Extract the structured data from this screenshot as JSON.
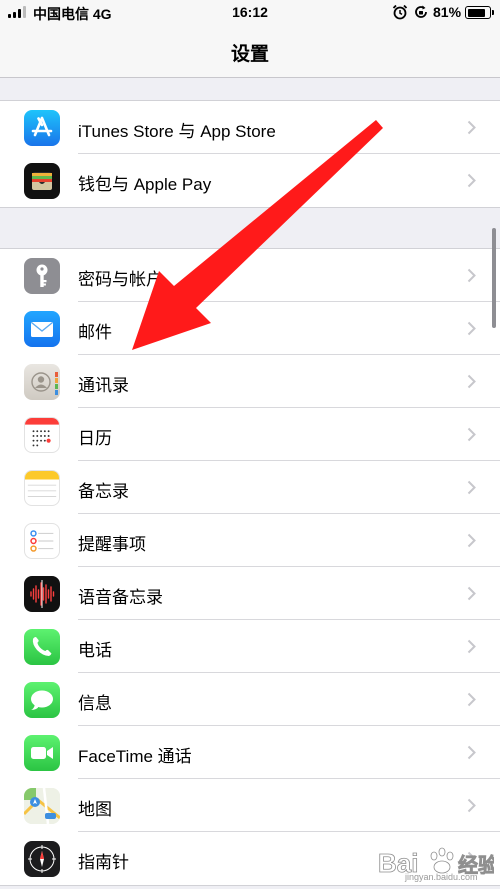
{
  "status_bar": {
    "carrier": "中国电信 4G",
    "time": "16:12",
    "battery_percent": "81%",
    "battery_level": 0.81,
    "signal_bars": 4,
    "signal_bars_active": 3
  },
  "nav": {
    "title": "设置"
  },
  "groups": [
    {
      "items": [
        {
          "label": "iTunes Store 与 App Store",
          "icon": "app-store-icon"
        },
        {
          "label": "钱包与 Apple Pay",
          "icon": "wallet-icon"
        }
      ]
    },
    {
      "items": [
        {
          "label": "密码与帐户",
          "icon": "key-icon"
        },
        {
          "label": "邮件",
          "icon": "mail-icon"
        },
        {
          "label": "通讯录",
          "icon": "contacts-icon"
        },
        {
          "label": "日历",
          "icon": "calendar-icon"
        },
        {
          "label": "备忘录",
          "icon": "notes-icon"
        },
        {
          "label": "提醒事项",
          "icon": "reminders-icon"
        },
        {
          "label": "语音备忘录",
          "icon": "voice-memos-icon"
        },
        {
          "label": "电话",
          "icon": "phone-icon"
        },
        {
          "label": "信息",
          "icon": "messages-icon"
        },
        {
          "label": "FaceTime 通话",
          "icon": "facetime-icon"
        },
        {
          "label": "地图",
          "icon": "maps-icon"
        },
        {
          "label": "指南针",
          "icon": "compass-icon"
        }
      ]
    }
  ],
  "watermark": {
    "url": "jingyan.baidu.com"
  },
  "colors": {
    "background": "#efeff4",
    "arrow": "#ff1a1a",
    "chevron": "#c7c7cc",
    "separator": "#d8d8dc"
  }
}
